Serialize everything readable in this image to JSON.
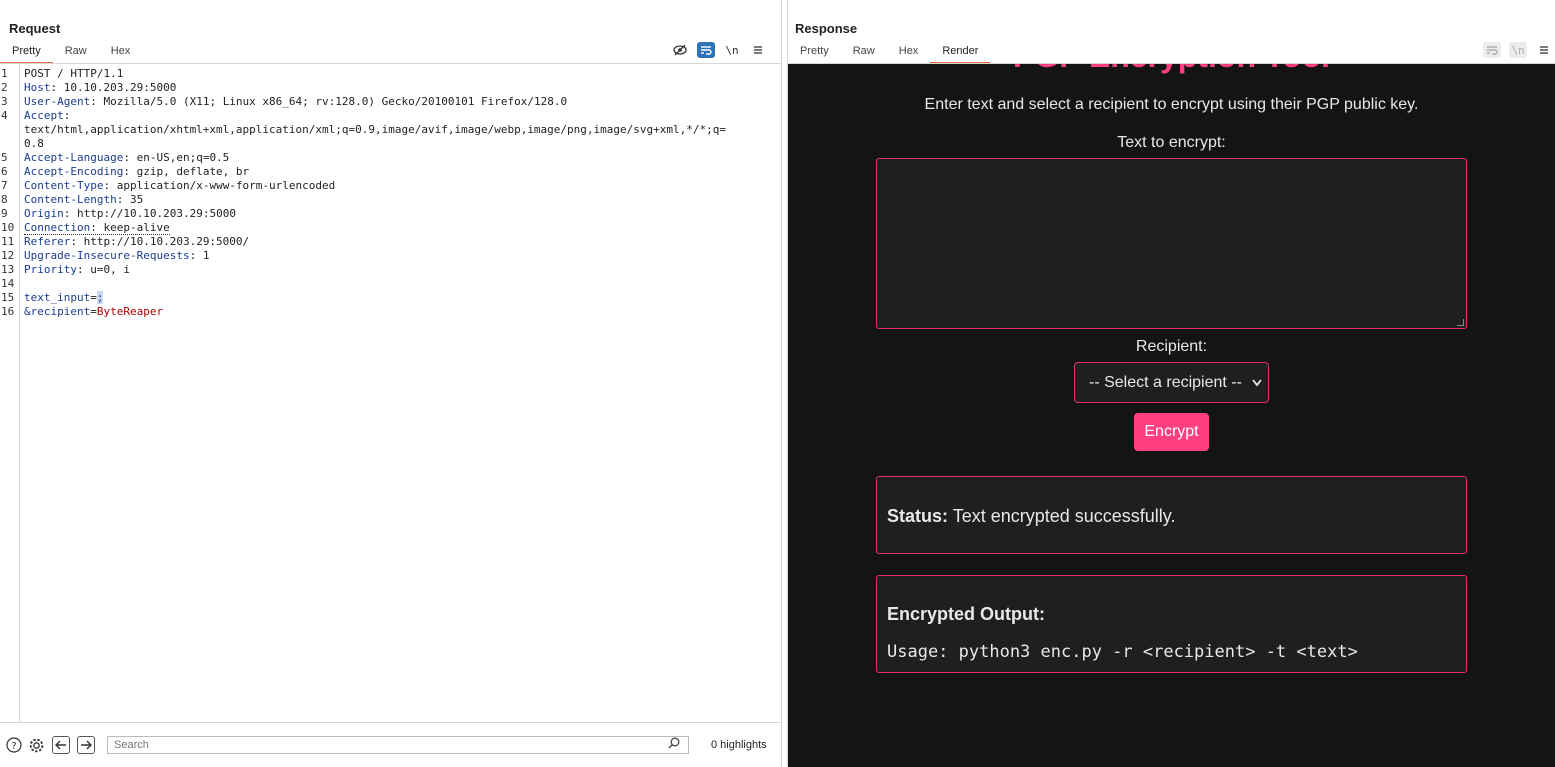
{
  "request": {
    "title": "Request",
    "tabs": [
      "Pretty",
      "Raw",
      "Hex"
    ],
    "lines": [
      {
        "n": "1",
        "plain": "POST / HTTP/1.1"
      },
      {
        "n": "2",
        "key": "Host",
        "val": " 10.10.203.29:5000"
      },
      {
        "n": "3",
        "key": "User-Agent",
        "val": " Mozilla/5.0 (X11; Linux x86_64; rv:128.0) Gecko/20100101 Firefox/128.0"
      },
      {
        "n": "4",
        "key": "Accept",
        "val": ""
      },
      {
        "n": "",
        "plain": "text/html,application/xhtml+xml,application/xml;q=0.9,image/avif,image/webp,image/png,image/svg+xml,*/*;q="
      },
      {
        "n": "",
        "plain": "0.8"
      },
      {
        "n": "5",
        "key": "Accept-Language",
        "val": " en-US,en;q=0.5"
      },
      {
        "n": "6",
        "key": "Accept-Encoding",
        "val": " gzip, deflate, br"
      },
      {
        "n": "7",
        "key": "Content-Type",
        "val": " application/x-www-form-urlencoded"
      },
      {
        "n": "8",
        "key": "Content-Length",
        "val": " 35"
      },
      {
        "n": "9",
        "key": "Origin",
        "val": " http://10.10.203.29:5000"
      },
      {
        "n": "10",
        "key": "Connection",
        "val": " keep-alive",
        "dotted": true
      },
      {
        "n": "11",
        "key": "Referer",
        "val": " http://10.10.203.29:5000/"
      },
      {
        "n": "12",
        "key": "Upgrade-Insecure-Requests",
        "val": " 1"
      },
      {
        "n": "13",
        "key": "Priority",
        "val": " u=0, i"
      },
      {
        "n": "14",
        "plain": ""
      },
      {
        "n": "15",
        "param": "text_input",
        "pval": ";",
        "selected": true
      },
      {
        "n": "16",
        "param": "&recipient",
        "pval": "ByteReaper"
      }
    ]
  },
  "bottom": {
    "search_placeholder": "Search",
    "highlights": "0 highlights"
  },
  "response": {
    "title": "Response",
    "tabs": [
      "Pretty",
      "Raw",
      "Hex",
      "Render"
    ],
    "active_tab": "Render",
    "render": {
      "heading": "PGP Encryption Tool",
      "intro": "Enter text and select a recipient to encrypt using their PGP public key.",
      "text_label": "Text to encrypt:",
      "recipient_label": "Recipient:",
      "select_value": "-- Select a recipient --",
      "button": "Encrypt",
      "status_label": "Status:",
      "status_text": " Text encrypted successfully.",
      "output_title": "Encrypted Output:",
      "output_code": "Usage: python3 enc.py -r <recipient> -t <text>"
    }
  },
  "colors": {
    "accent": "#ff3f7f",
    "render_bg": "#141414",
    "active_tab_underline": "#e5673a"
  }
}
